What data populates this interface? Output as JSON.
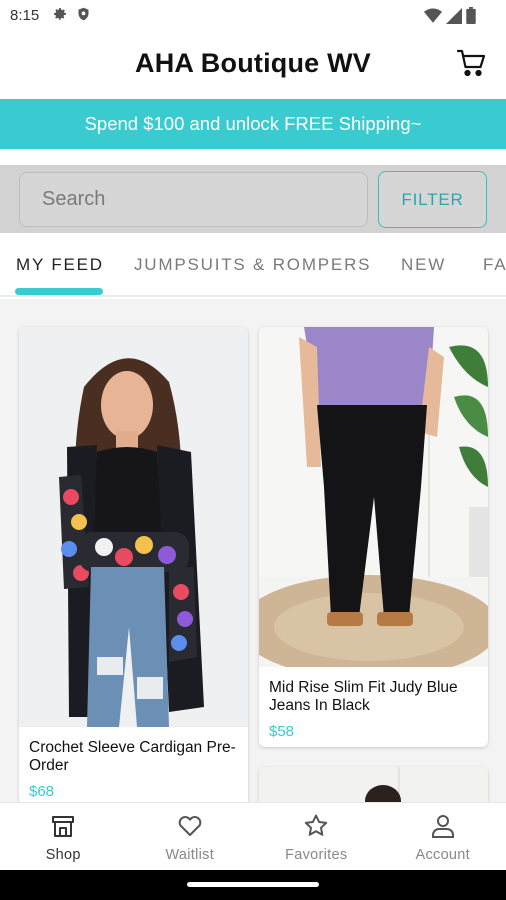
{
  "status_bar": {
    "time": "8:15"
  },
  "header": {
    "title": "AHA Boutique WV",
    "cart_icon": "cart-icon"
  },
  "promo": {
    "text": "Spend $100 and unlock FREE Shipping~",
    "color": "#39cbcf"
  },
  "search": {
    "placeholder": "Search",
    "filter_label": "FILTER"
  },
  "tabs": [
    {
      "label": "MY FEED",
      "active": true
    },
    {
      "label": "JUMPSUITS & ROMPERS",
      "active": false
    },
    {
      "label": "NEW",
      "active": false
    },
    {
      "label": "FA",
      "active": false
    }
  ],
  "products": [
    {
      "title": "Crochet Sleeve Cardigan Pre-Order",
      "price": "$68"
    },
    {
      "title": "Mid Rise Slim Fit Judy Blue Jeans In Black",
      "price": "$58"
    }
  ],
  "bottom_nav": [
    {
      "label": "Shop",
      "icon": "shop-icon",
      "active": true
    },
    {
      "label": "Waitlist",
      "icon": "heart-icon",
      "active": false
    },
    {
      "label": "Favorites",
      "icon": "star-icon",
      "active": false
    },
    {
      "label": "Account",
      "icon": "account-icon",
      "active": false
    }
  ],
  "colors": {
    "accent": "#39cbcf",
    "price": "#39cbcf"
  }
}
